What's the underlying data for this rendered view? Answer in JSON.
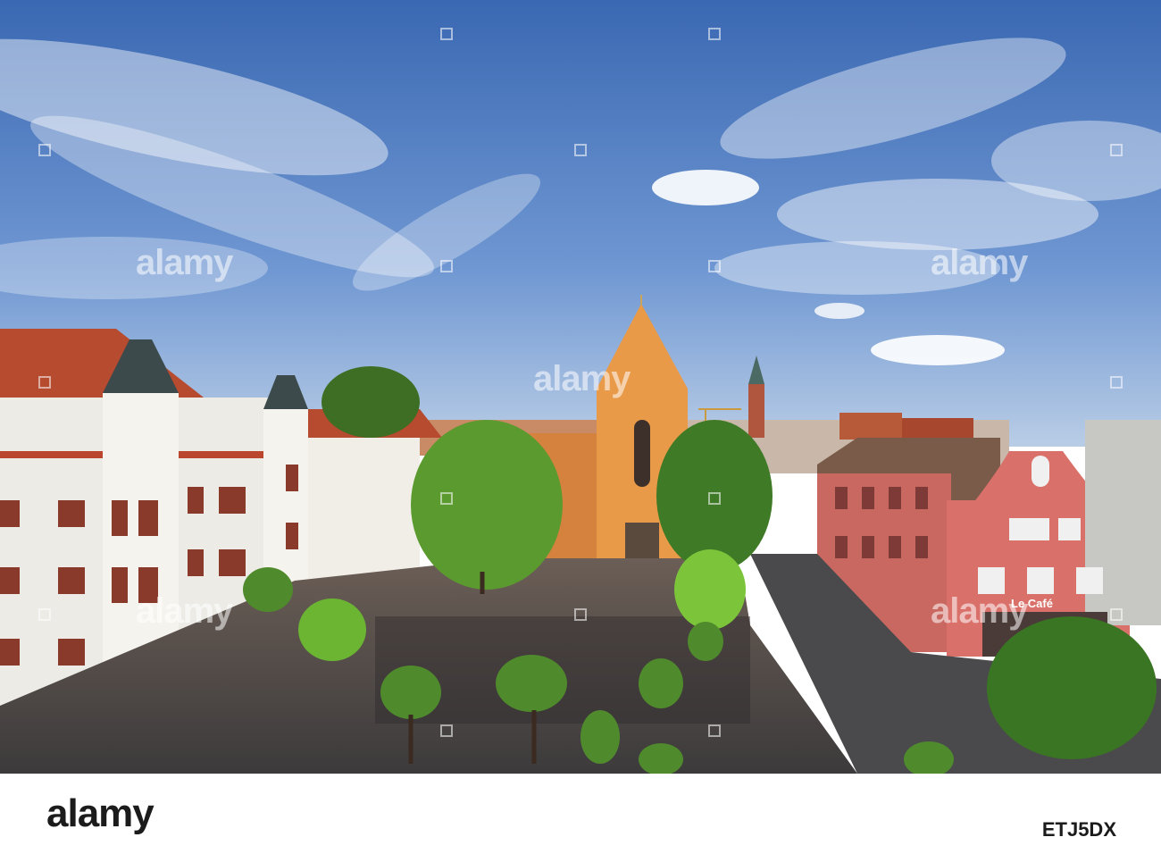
{
  "photo": {
    "subject": "town square with church, trees and historic buildings",
    "shop_sign": "Le Café",
    "colors": {
      "sky_top": "#3f6fb8",
      "sky_bottom": "#8fb2de",
      "church": "#e79a4a",
      "roof": "#b54a2e",
      "pink_building": "#d9716a",
      "trees": "#4f8a2c"
    }
  },
  "watermark": {
    "text": "alamy",
    "icon": "alamy-square-icon"
  },
  "footer": {
    "logo": "alamy",
    "image_id": "ETJ5DX",
    "background": "#ffffff"
  }
}
